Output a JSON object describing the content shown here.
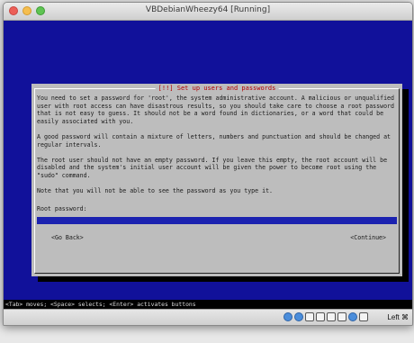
{
  "window": {
    "title": "VBDebianWheezy64 [Running]"
  },
  "dialog": {
    "title": "[!!] Set up users and passwords",
    "paragraphs": [
      "You need to set a password for 'root', the system administrative account. A malicious or unqualified user with root access can have disastrous results, so you should take care to choose a root password that is not easy to guess. It should not be a word found in dictionaries, or a word that could be easily associated with you.",
      "A good password will contain a mixture of letters, numbers and punctuation and should be changed at regular intervals.",
      "The root user should not have an empty password. If you leave this empty, the root account will be disabled and the system's initial user account will be given the power to become root using the \"sudo\" command.",
      "Note that you will not be able to see the password as you type it."
    ],
    "password_label": "Root password:",
    "password_value": "",
    "go_back_label": "<Go Back>",
    "continue_label": "<Continue>"
  },
  "helpline": "<Tab> moves; <Space> selects; <Enter> activates buttons",
  "statusbar": {
    "host_key": "Left ⌘",
    "icons": [
      "hard-disk-icon",
      "optical-drive-icon",
      "usb-icon",
      "shared-folder-icon",
      "network-icon",
      "display-icon",
      "capture-icon",
      "mouse-integration-icon"
    ]
  },
  "colors": {
    "screen_bg": "#11119a",
    "dialog_bg": "#bdbdbd",
    "dialog_title": "#b30000",
    "input_field": "#1b22b0"
  }
}
